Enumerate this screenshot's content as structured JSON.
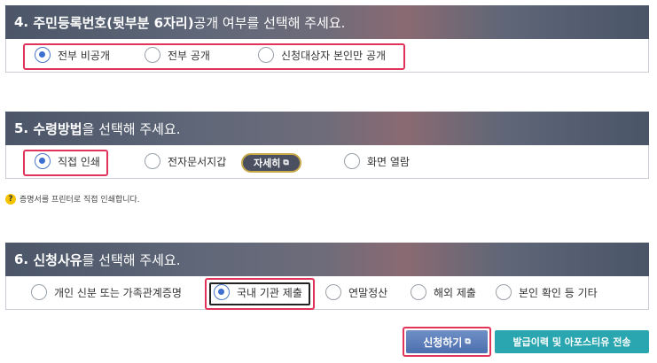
{
  "section4": {
    "number": "4.",
    "title_bold": "주민등록번호(뒷부분 6자리)",
    "title_rest": " 공개 여부를 선택해 주세요.",
    "options": [
      "전부 비공개",
      "전부 공개",
      "신청대상자 본인만 공개"
    ],
    "selected": 0
  },
  "section5": {
    "number": "5.",
    "title_bold": "수령방법",
    "title_rest": "을 선택해 주세요.",
    "options": [
      "직접 인쇄",
      "전자문서지갑",
      "화면 열람"
    ],
    "detail_button": "자세히",
    "selected": 0,
    "help_text": "증명서를 프린터로 직접 인쇄합니다."
  },
  "section6": {
    "number": "6.",
    "title_bold": "신청사유",
    "title_rest": "를 선택해 주세요.",
    "options": [
      "개인 신분 또는 가족관계증명",
      "국내 기관 제출",
      "연말정산",
      "해외 제출",
      "본인 확인 등 기타"
    ],
    "selected": 1
  },
  "buttons": {
    "apply": "신청하기",
    "history": "발급이력 및 아포스티유 전송"
  },
  "colors": {
    "highlight_border": "#e0345a",
    "radio_selected": "#3d6fd0",
    "history_button": "#2aa6b0"
  }
}
